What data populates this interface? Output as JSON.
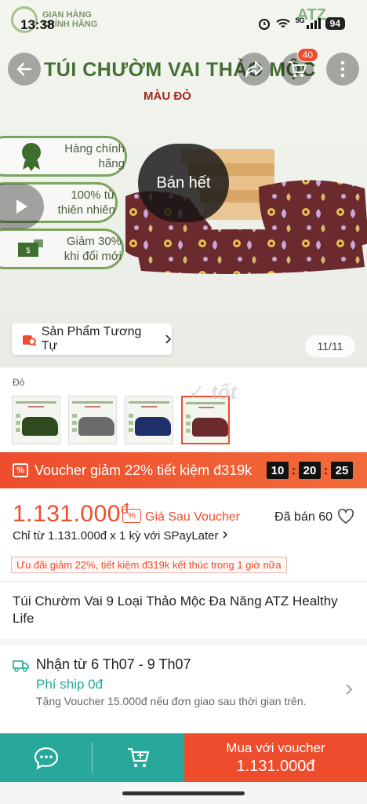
{
  "status_bar": {
    "time": "13:38",
    "network": "5G",
    "battery": "94"
  },
  "hero": {
    "brand_left": [
      "GIAN HÀNG",
      "CHÍNH HÃNG"
    ],
    "brand_right": "ATZ",
    "title": "TÚI CHƯỜM VAI THẢO MỘC",
    "subtitle": "MÀU ĐỎ",
    "features": [
      {
        "label": "Hàng chính hãng"
      },
      {
        "label": "100% từ thiên nhiên"
      },
      {
        "label": "Giảm 30% khi đổi mới"
      }
    ],
    "sold_out_label": "Bán hết",
    "cart_count": "40",
    "similar_products_label": "Sản Phẩm Tương Tự",
    "page_indicator": "11/11",
    "product_colors": {
      "fabric": "#6a2a2e",
      "print": "#e8c24a",
      "flower": "#c8a8d8",
      "box": "#e8c08a"
    }
  },
  "variants": {
    "label": "Đỏ",
    "thumbs": [
      {
        "color": "#2e4a1e"
      },
      {
        "color": "#6b6b6b"
      },
      {
        "color": "#1f2f6a"
      },
      {
        "color": "#6a2a2e"
      }
    ],
    "active_index": 3
  },
  "voucher_banner": {
    "text": "Voucher giảm 22% tiết kiệm đ319k",
    "timer": [
      "10",
      "20",
      "25"
    ]
  },
  "price": {
    "amount": "1.131.000",
    "currency": "đ",
    "after_voucher_label": "Giá Sau Voucher",
    "sold_label": "Đã bán 60",
    "spaylater": "Chỉ từ 1.131.000đ x 1 kỳ với SPayLater",
    "promo": "Ưu đãi giảm 22%, tiết kiệm đ319k kết thúc trong 1 giờ nữa"
  },
  "product": {
    "title": "Túi Chườm Vai 9 Loại Thảo Mộc Đa Năng ATZ Healthy Life"
  },
  "shipping": {
    "date": "Nhận từ 6 Th07 - 9 Th07",
    "fee": "Phí ship 0đ",
    "voucher_note": "Tặng Voucher 15.000đ nếu đơn giao sau thời gian trên."
  },
  "bottom_bar": {
    "buy_label": "Mua với voucher",
    "buy_price": "1.131.000đ"
  },
  "colors": {
    "accent": "#ee4d2d",
    "teal": "#27a89a",
    "green_text": "#3c6a2c"
  }
}
